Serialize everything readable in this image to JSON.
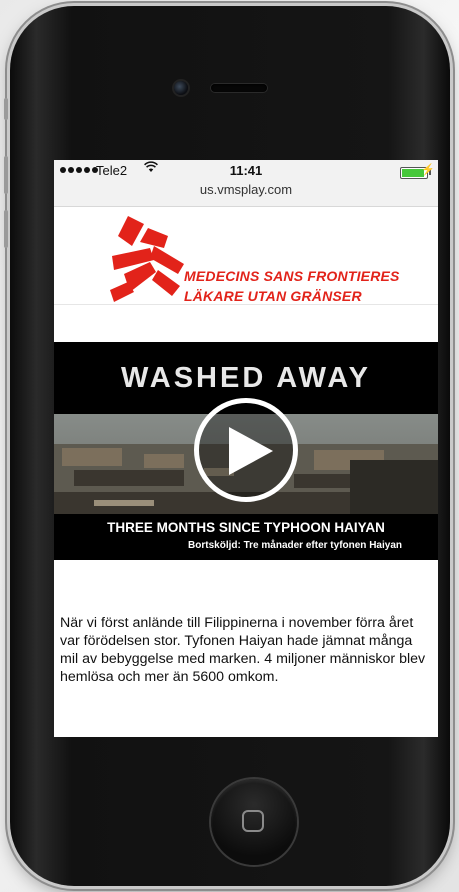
{
  "status_bar": {
    "carrier": "Tele2",
    "time": "11:41",
    "battery_level": 1.0,
    "battery_color": "#46c83a"
  },
  "browser": {
    "url": "us.vmsplay.com"
  },
  "logo": {
    "line1": "MEDECINS SANS FRONTIERES",
    "line2": "LÄKARE UTAN GRÄNSER",
    "brand_color": "#e2231a"
  },
  "video": {
    "title": "WASHED AWAY",
    "subtitle": "THREE MONTHS SINCE TYPHOON HAIYAN",
    "subtitle_translation": "Bortsköljd: Tre månader efter tyfonen Haiyan",
    "play_icon": "play-icon"
  },
  "article": {
    "text": "När vi först anlände till Filippinerna i november förra året var förödelsen stor. Tyfonen Haiyan hade jämnat många mil av bebyggelse med marken. 4 miljoner människor blev hemlösa och mer än 5600 omkom."
  },
  "device": {
    "home_icon": "home-square-icon"
  }
}
